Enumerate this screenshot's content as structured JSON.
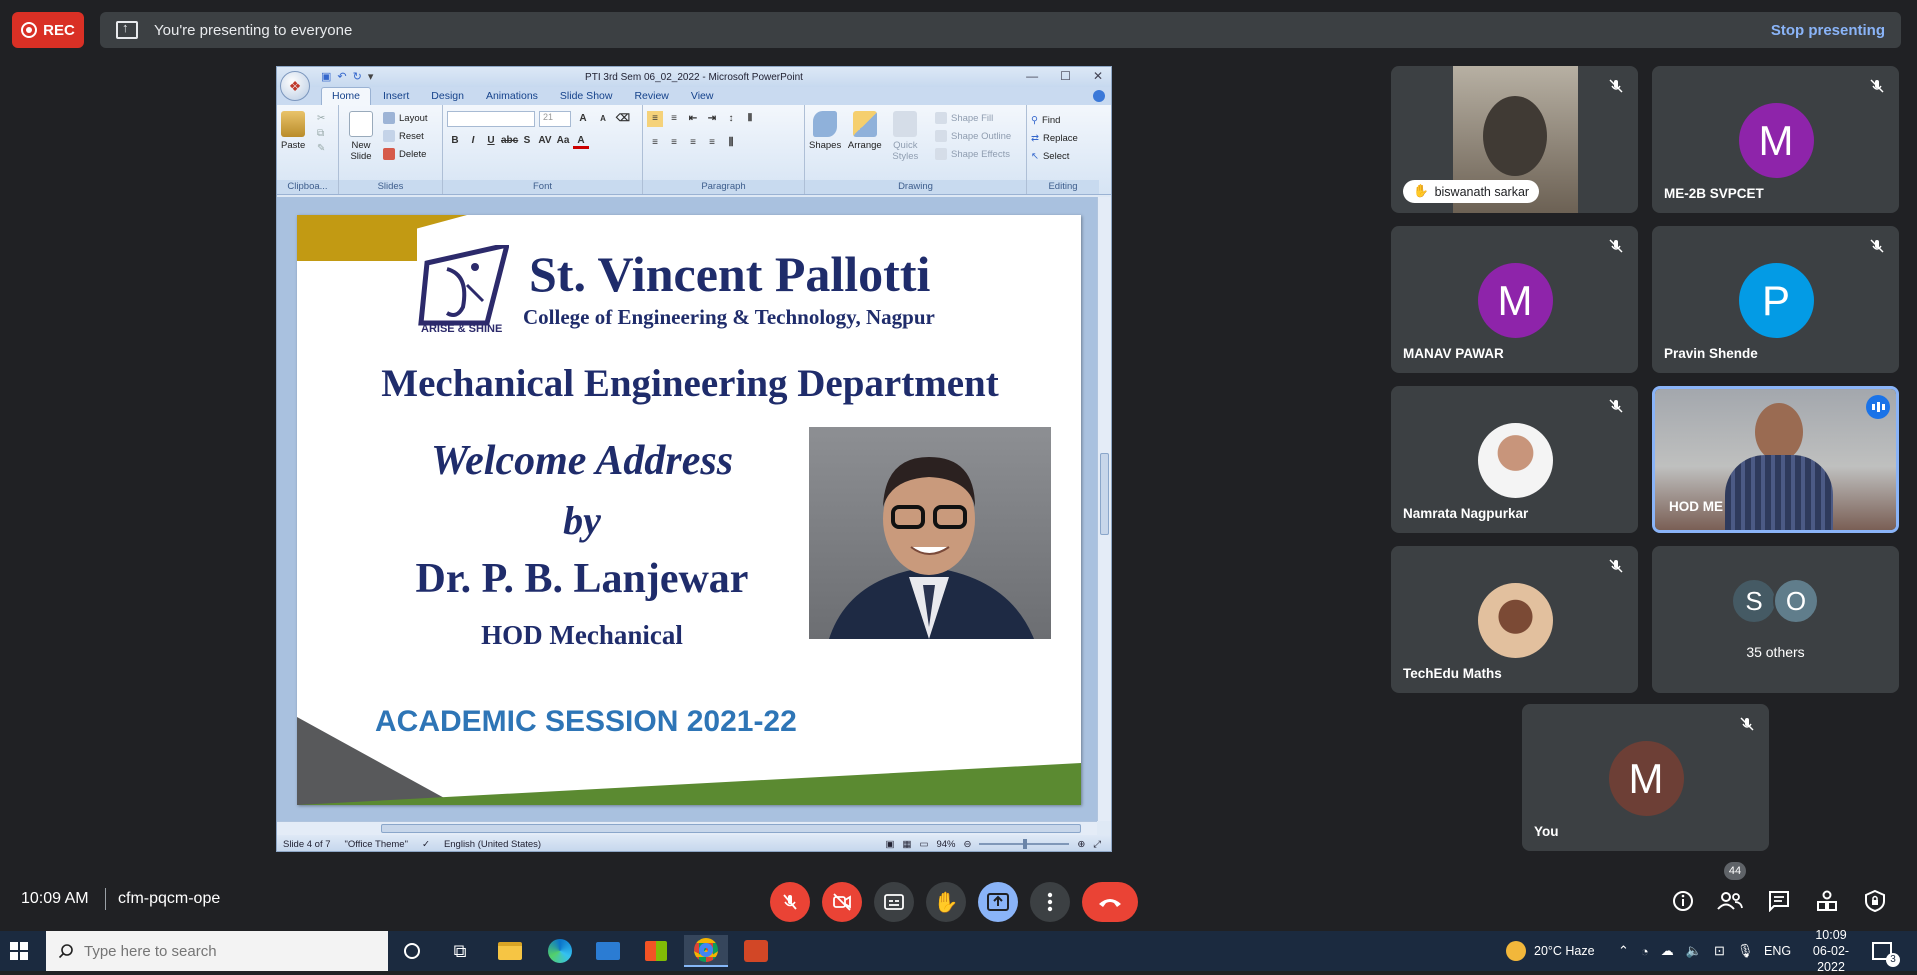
{
  "top": {
    "rec_label": "REC",
    "presenting_text": "You're presenting to everyone",
    "stop_label": "Stop presenting"
  },
  "ppt": {
    "window_title": "PTI 3rd Sem 06_02_2022 - Microsoft PowerPoint",
    "tabs": [
      "Home",
      "Insert",
      "Design",
      "Animations",
      "Slide Show",
      "Review",
      "View"
    ],
    "groups": {
      "clipboard": "Clipboa...",
      "slides": "Slides",
      "font": "Font",
      "paragraph": "Paragraph",
      "drawing": "Drawing",
      "editing": "Editing"
    },
    "buttons": {
      "paste": "Paste",
      "new_slide": "New Slide",
      "layout": "Layout",
      "reset": "Reset",
      "delete": "Delete",
      "font_size": "21",
      "shapes": "Shapes",
      "arrange": "Arrange",
      "quick_styles": "Quick Styles",
      "shape_fill": "Shape Fill",
      "shape_outline": "Shape Outline",
      "shape_effects": "Shape Effects",
      "find": "Find",
      "replace": "Replace",
      "select": "Select"
    },
    "status": {
      "slide": "Slide 4 of 7",
      "theme": "\"Office Theme\"",
      "language": "English (United States)",
      "zoom": "94%"
    },
    "slide": {
      "logo_caption": "ARISE & SHINE",
      "title": "St. Vincent Pallotti",
      "subtitle": "College of Engineering & Technology,  Nagpur",
      "department": "Mechanical Engineering Department",
      "welcome": "Welcome Address",
      "by": "by",
      "speaker": "Dr. P. B. Lanjewar",
      "role": "HOD Mechanical",
      "session": "ACADEMIC SESSION 2021-22"
    }
  },
  "participants": [
    {
      "name": "biswanath sarkar",
      "type": "video"
    },
    {
      "name": "ME-2B SVPCET",
      "initial": "M",
      "color": "#8e24aa"
    },
    {
      "name": "MANAV PAWAR",
      "initial": "M",
      "color": "#8e24aa"
    },
    {
      "name": "Pravin Shende",
      "initial": "P",
      "color": "#039be5"
    },
    {
      "name": "Namrata Nagpurkar",
      "type": "photo"
    },
    {
      "name": "HOD ME",
      "type": "video"
    },
    {
      "name": "TechEdu Maths",
      "type": "photo"
    },
    {
      "others_label": "35 others",
      "initials": [
        "S",
        "O"
      ]
    },
    {
      "name": "You",
      "initial": "M",
      "color": "#6d3f36"
    }
  ],
  "meeting": {
    "time": "10:09 AM",
    "code": "cfm-pqcm-ope",
    "people_count": "44"
  },
  "taskbar": {
    "search_placeholder": "Type here to search",
    "weather": "20°C  Haze",
    "lang": "ENG",
    "clock_time": "10:09",
    "clock_date": "06-02-2022",
    "notif_count": "3"
  }
}
